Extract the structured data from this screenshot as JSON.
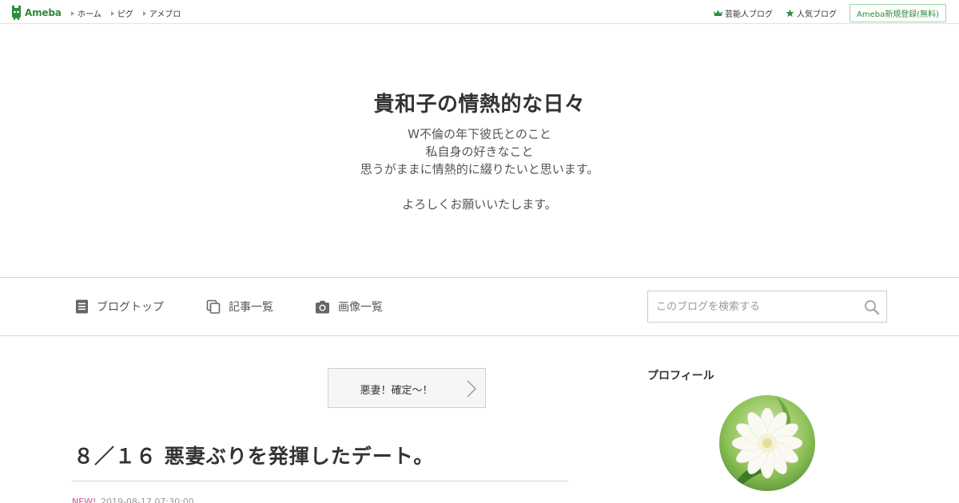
{
  "topbar": {
    "logo_text": "Ameba",
    "nav": [
      {
        "label": "ホーム"
      },
      {
        "label": "ピグ"
      },
      {
        "label": "アメブロ"
      }
    ],
    "right_links": [
      {
        "label": "芸能人ブログ",
        "icon": "crown-icon"
      },
      {
        "label": "人気ブログ",
        "icon": "star-icon"
      }
    ],
    "register_label": "Ameba新規登録(無料)"
  },
  "header": {
    "title": "貴和子の情熱的な日々",
    "description_lines": [
      "W不倫の年下彼氏とのこと",
      "私自身の好きなこと",
      "思うがままに情熱的に綴りたいと思います。",
      "",
      "よろしくお願いいたします。"
    ]
  },
  "menu": {
    "items": [
      {
        "label": "ブログトップ",
        "icon": "document-icon"
      },
      {
        "label": "記事一覧",
        "icon": "copy-icon"
      },
      {
        "label": "画像一覧",
        "icon": "camera-icon"
      }
    ],
    "search_placeholder": "このブログを検索する"
  },
  "next_entry": {
    "label": "悪妻！確定～！"
  },
  "article": {
    "title": "８／１６ 悪妻ぶりを発揮したデート。",
    "new_badge": "NEW!",
    "date": "2019-08-17 07:30:00"
  },
  "sidebar": {
    "profile_heading": "プロフィール"
  },
  "colors": {
    "brand_green": "#2d8c3c",
    "new_pink": "#d1498f"
  }
}
